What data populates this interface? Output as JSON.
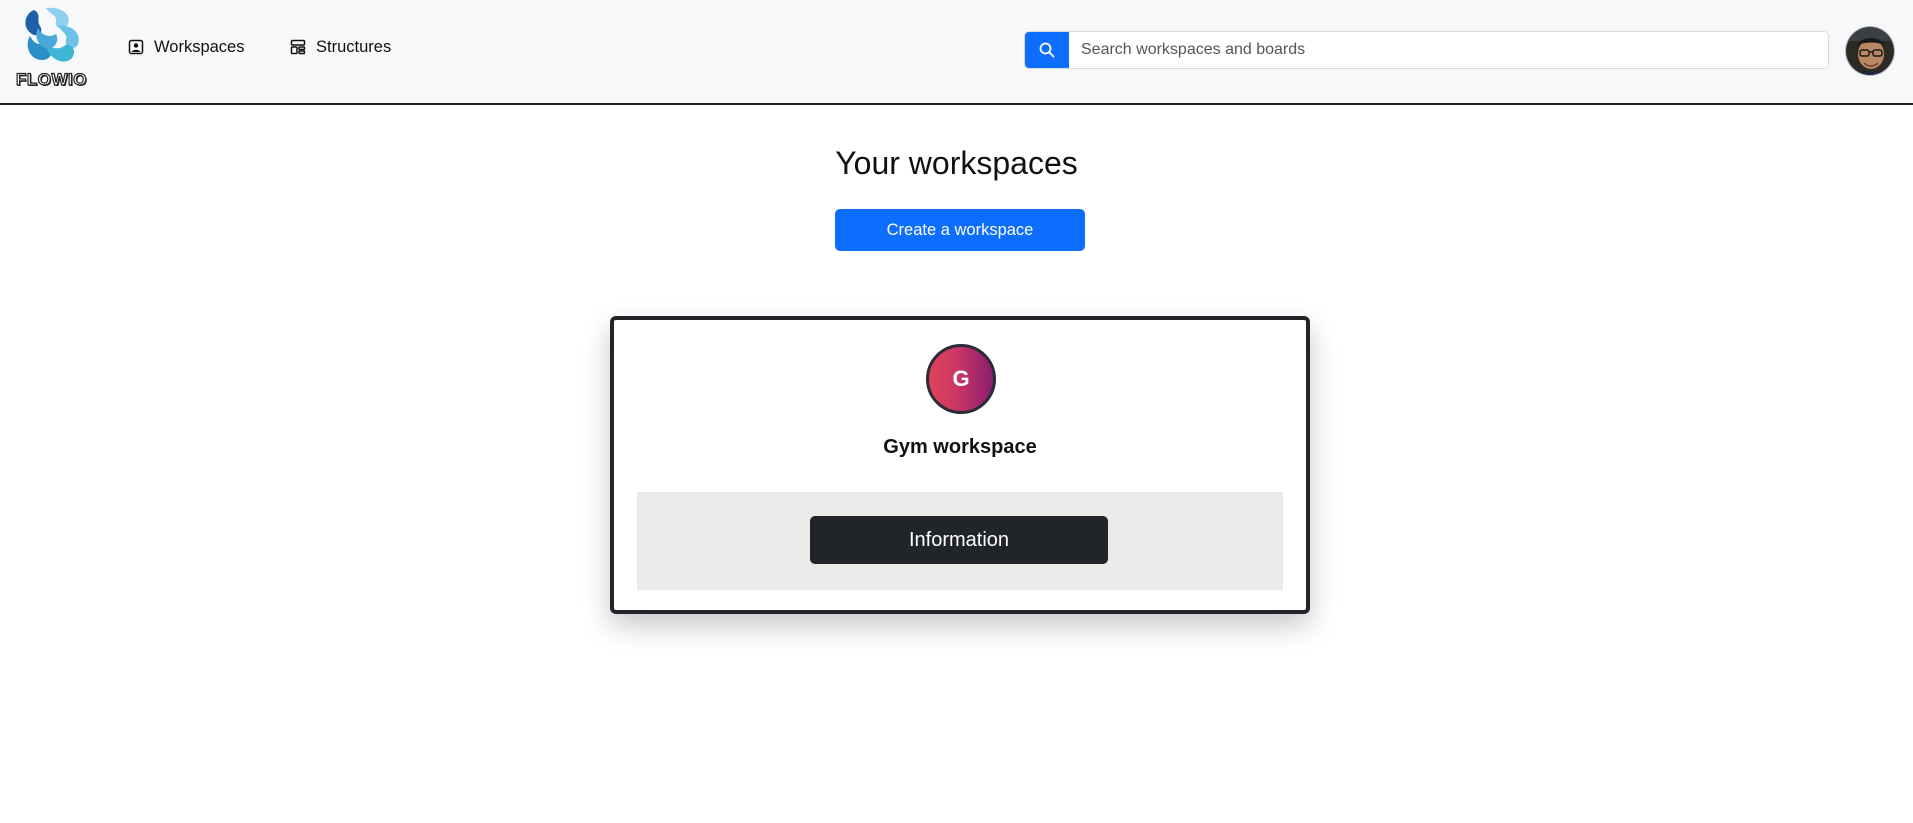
{
  "brand": {
    "name": "FLOWIO",
    "logo_icon": "flowio-logo"
  },
  "nav": {
    "items": [
      {
        "label": "Workspaces",
        "icon": "workspace-person-icon"
      },
      {
        "label": "Structures",
        "icon": "layout-template-icon"
      }
    ]
  },
  "search": {
    "placeholder": "Search workspaces and boards",
    "value": "",
    "icon": "search-icon"
  },
  "user": {
    "avatar_icon": "user-avatar-photo"
  },
  "main": {
    "title": "Your workspaces",
    "create_button_label": "Create a workspace",
    "workspaces": [
      {
        "initial": "G",
        "name": "Gym workspace",
        "info_button_label": "Information"
      }
    ]
  },
  "colors": {
    "primary": "#0d6efd",
    "dark": "#212529",
    "navbar_bg": "#f7f8fa",
    "card_footer_bg": "#ecebe9",
    "avatar_gradient_start": "#e0435a",
    "avatar_gradient_end": "#8b1d6e"
  }
}
